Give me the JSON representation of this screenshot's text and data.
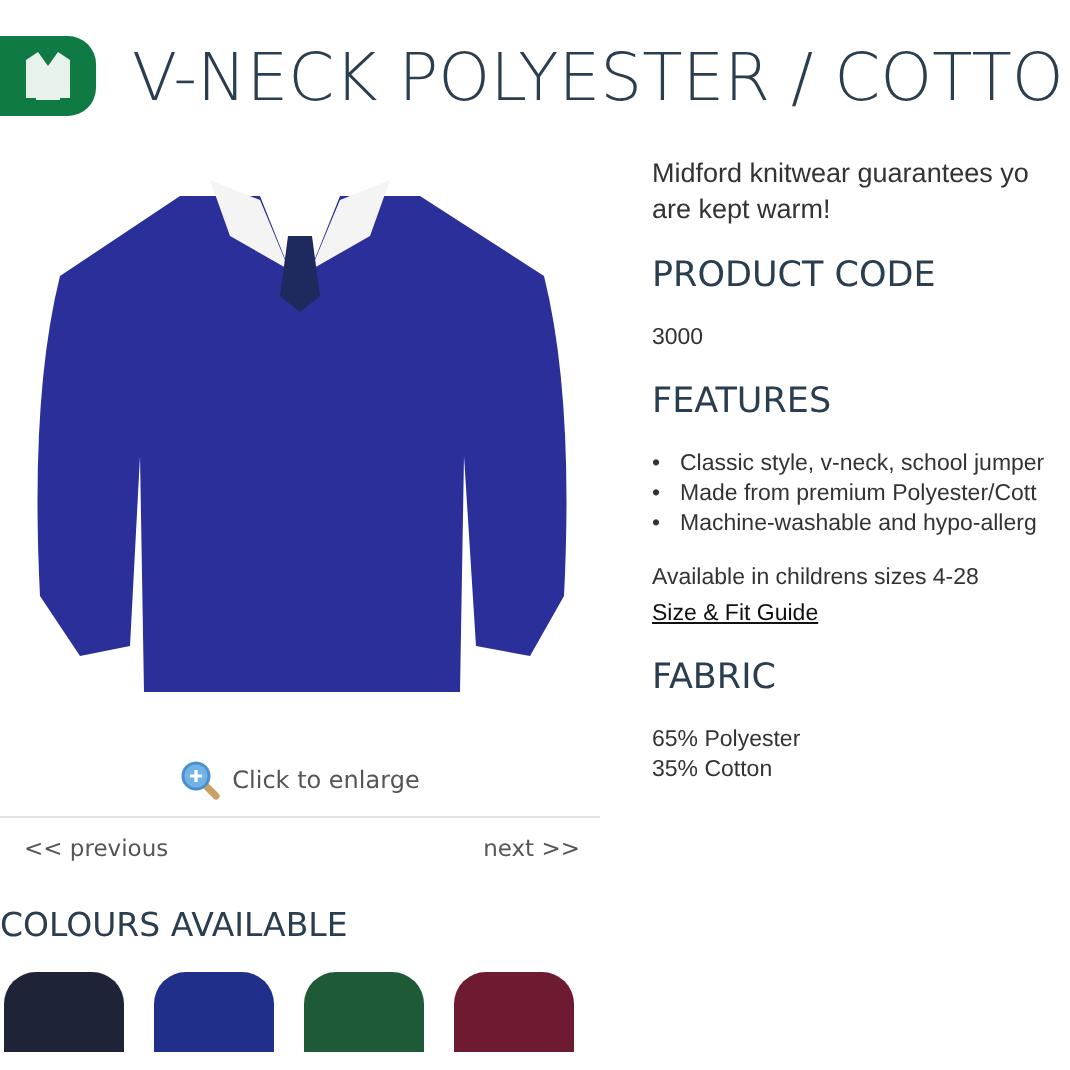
{
  "header": {
    "title": "V-NECK POLYESTER / COTTO"
  },
  "gallery": {
    "enlarge_label": "Click to enlarge",
    "previous": "<< previous",
    "next": "next >>"
  },
  "colours": {
    "heading": "COLOURS AVAILABLE",
    "swatches": [
      {
        "color": "#1e2338"
      },
      {
        "color": "#1f2f8a"
      },
      {
        "color": "#1f5a38"
      },
      {
        "color": "#6e1a30"
      }
    ]
  },
  "details": {
    "intro": [
      "Midford knitwear guarantees yo",
      "are kept warm!"
    ],
    "sections": [
      {
        "heading": "PRODUCT CODE",
        "kind": "text",
        "lines": [
          "3000"
        ]
      },
      {
        "heading": "FEATURES",
        "kind": "bullets",
        "marker": "•",
        "lines": [
          "Classic style, v-neck, school jumper",
          "Made from premium Polyester/Cott",
          "Machine-washable and hypo-allerg"
        ],
        "note": "Available in childrens sizes 4-28",
        "link": "Size & Fit Guide"
      },
      {
        "heading": "FABRIC",
        "kind": "text",
        "lines": [
          "65% Polyester",
          "35% Cotton"
        ]
      }
    ]
  }
}
